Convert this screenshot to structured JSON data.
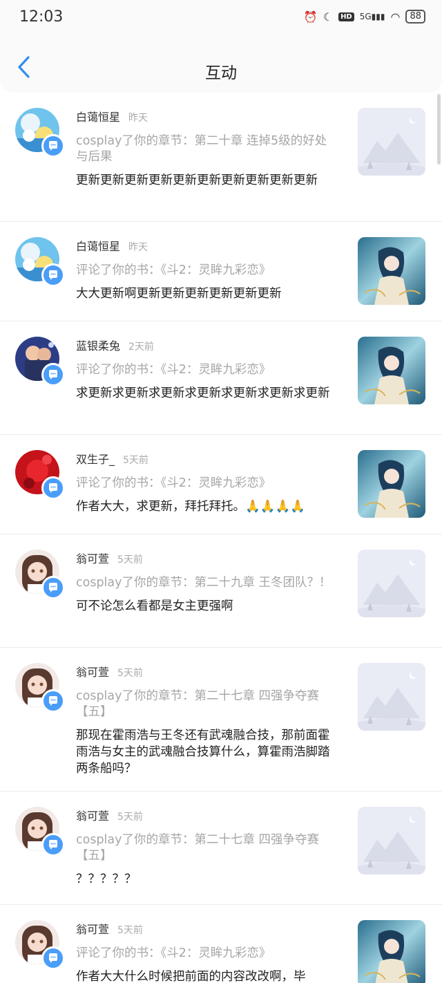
{
  "status_bar": {
    "time": "12:03",
    "battery": "88"
  },
  "header": {
    "title": "互动"
  },
  "items": [
    {
      "user": "白蔼恒星",
      "time": "昨天",
      "action": "cosplay了你的章节：第二十章 连掉5级的好处与后果",
      "comment": "更新更新更新更新更新更新更新更新更新更新",
      "avatar": "sky",
      "thumb": "placeholder"
    },
    {
      "user": "白蔼恒星",
      "time": "昨天",
      "action": "评论了你的书：《斗2：灵眸九彩恋》",
      "comment": "大大更新啊更新更新更新更新更新更新",
      "avatar": "sky",
      "thumb": "cover"
    },
    {
      "user": "蓝银柔兔",
      "time": "2天前",
      "action": "评论了你的书：《斗2：灵眸九彩恋》",
      "comment": "求更新求更新求更新求更新求更新求更新求更新",
      "avatar": "night",
      "thumb": "cover"
    },
    {
      "user": "双生子_",
      "time": "5天前",
      "action": "评论了你的书：《斗2：灵眸九彩恋》",
      "comment": "作者大大，求更新，拜托拜托。🙏🙏🙏🙏",
      "avatar": "red",
      "thumb": "cover"
    },
    {
      "user": "翁可萱",
      "time": "5天前",
      "action": "cosplay了你的章节：第二十九章 王冬团队？！",
      "comment": "可不论怎么看都是女主更强啊",
      "avatar": "girl",
      "thumb": "placeholder"
    },
    {
      "user": "翁可萱",
      "time": "5天前",
      "action": "cosplay了你的章节：第二十七章 四强争夺赛【五】",
      "comment": "那现在霍雨浩与王冬还有武魂融合技，那前面霍雨浩与女主的武魂融合技算什么，算霍雨浩脚踏两条船吗？",
      "avatar": "girl",
      "thumb": "placeholder"
    },
    {
      "user": "翁可萱",
      "time": "5天前",
      "action": "cosplay了你的章节：第二十七章 四强争夺赛【五】",
      "comment": "？？？？？",
      "avatar": "girl",
      "thumb": "placeholder"
    },
    {
      "user": "翁可萱",
      "time": "5天前",
      "action": "评论了你的书：《斗2：灵眸九彩恋》",
      "comment": "作者大大什么时候把前面的内容改改啊，毕",
      "avatar": "girl",
      "thumb": "cover"
    }
  ]
}
